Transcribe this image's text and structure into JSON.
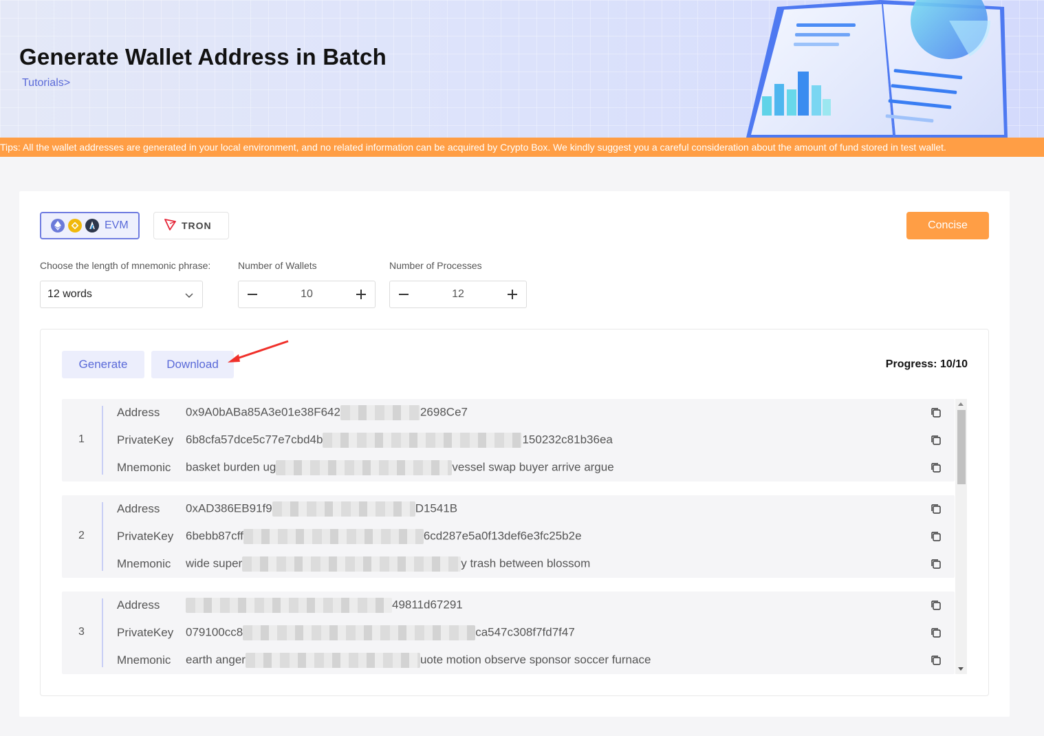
{
  "header": {
    "title": "Generate Wallet Address in Batch",
    "tutorials_link": "Tutorials>"
  },
  "tips": "Tips: All the wallet addresses are generated in your local environment, and no related information can be acquired by Crypto Box. We kindly suggest you a careful consideration about the amount of fund stored in test wallet.",
  "chains": {
    "evm": {
      "label": "EVM",
      "selected": true,
      "icons": [
        "ethereum-icon",
        "bnb-icon",
        "arbitrum-icon"
      ]
    },
    "tron": {
      "label": "TRON",
      "selected": false,
      "icons": [
        "tron-icon"
      ]
    }
  },
  "concise_button": "Concise",
  "form": {
    "mnemonic_label": "Choose the length of mnemonic phrase:",
    "mnemonic_value": "12 words",
    "wallets_label": "Number of Wallets",
    "wallets_value": "10",
    "processes_label": "Number of Processes",
    "processes_value": "12"
  },
  "actions": {
    "generate": "Generate",
    "download": "Download"
  },
  "progress": {
    "label": "Progress:",
    "value": "10/10"
  },
  "wallet_keys": {
    "address": "Address",
    "private_key": "PrivateKey",
    "mnemonic": "Mnemonic"
  },
  "wallets": [
    {
      "index": "1",
      "address_start": "0x9A0bABa85A3e01e38F642",
      "address_end": "2698Ce7",
      "private_key_start": "6b8cfa57dce5c77e7cbd4b",
      "private_key_end": "150232c81b36ea",
      "mnemonic_start": "basket burden ug",
      "mnemonic_end": "vessel swap buyer arrive argue"
    },
    {
      "index": "2",
      "address_start": "0xAD386EB91f9",
      "address_end": "D1541B",
      "private_key_start": "6bebb87cff",
      "private_key_end": "6cd287e5a0f13def6e3fc25b2e",
      "mnemonic_start": "wide super",
      "mnemonic_end": "y trash between blossom"
    },
    {
      "index": "3",
      "address_start": "",
      "address_end": "49811d67291",
      "private_key_start": "079100cc8",
      "private_key_end": "ca547c308f7fd7f47",
      "mnemonic_start": "earth anger",
      "mnemonic_end": "uote motion observe sponsor soccer furnace"
    }
  ],
  "colors": {
    "accent": "#5a6ad8",
    "orange": "#ff9e45",
    "tip_text": "#ffffff"
  }
}
